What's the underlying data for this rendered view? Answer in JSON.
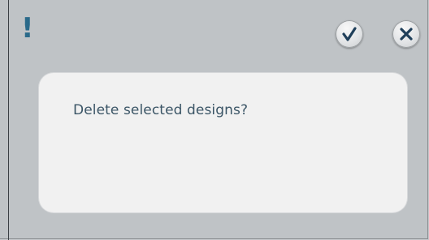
{
  "dialog": {
    "alert_mark": "!",
    "confirm_icon": "checkmark-icon",
    "cancel_icon": "close-icon",
    "message": "Delete selected designs?"
  },
  "colors": {
    "background": "#bfc3c6",
    "panel": "#f1f1f1",
    "alert_mark": "#2a6a8a",
    "message_text": "#3b5566",
    "button_icon": "#1f3f5a"
  }
}
